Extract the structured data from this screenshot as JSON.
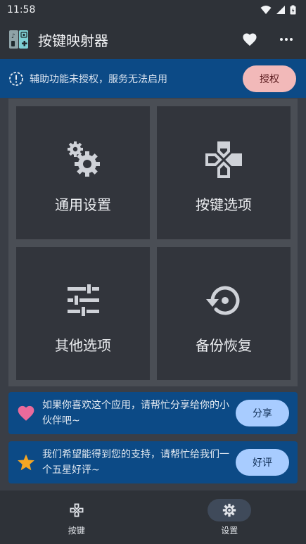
{
  "status_bar": {
    "time": "11:58"
  },
  "app_bar": {
    "title": "按键映射器"
  },
  "banner": {
    "text": "辅助功能未授权，服务无法启用",
    "button": "授权"
  },
  "tiles": [
    {
      "label": "通用设置"
    },
    {
      "label": "按键选项"
    },
    {
      "label": "其他选项"
    },
    {
      "label": "备份恢复"
    }
  ],
  "cards": [
    {
      "text": "如果你喜欢这个应用，请帮忙分享给你的小伙伴吧~",
      "button": "分享"
    },
    {
      "text": "我们希望能得到您的支持，请帮忙给我们一个五星好评~",
      "button": "好评"
    }
  ],
  "nav": [
    {
      "label": "按键",
      "active": false
    },
    {
      "label": "设置",
      "active": true
    }
  ],
  "colors": {
    "bar": "#2e3238",
    "banner": "#0c4a86",
    "tile": "#32353c",
    "auth_button": "#f2b9b9",
    "card_button": "#a8ccff",
    "heart": "#e96a9b",
    "star": "#f5a623"
  }
}
